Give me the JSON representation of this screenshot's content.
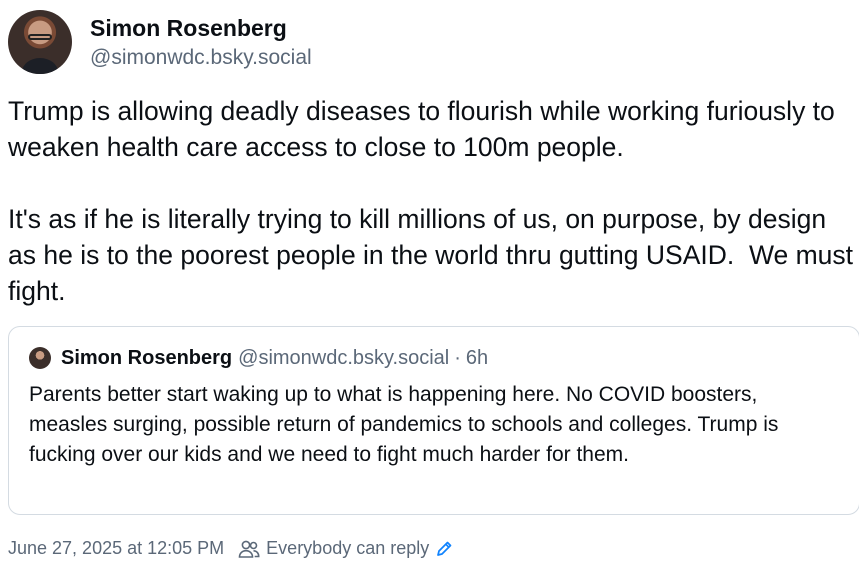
{
  "author": {
    "display_name": "Simon Rosenberg",
    "handle": "@simonwdc.bsky.social"
  },
  "post": {
    "text": "Trump is allowing deadly diseases to flourish while working furiously to weaken health care access to close to 100m people.\n\nIt's as if he is literally trying to kill millions of us, on purpose, by design as he is to the poorest people in the world thru gutting USAID.  We must fight."
  },
  "quote": {
    "display_name": "Simon Rosenberg",
    "handle": "@simonwdc.bsky.social",
    "separator": "·",
    "time": "6h",
    "text": "Parents better start waking up to what is happening here.  No COVID boosters, measles surging, possible return of pandemics to schools and colleges.  Trump is fucking over our kids and we need to fight much harder for them."
  },
  "meta": {
    "date": "June 27, 2025 at 12:05 PM",
    "reply_setting": "Everybody can reply",
    "people_icon": "people-icon",
    "edit_icon": "pencil-icon"
  },
  "colors": {
    "text_primary": "#0b0f14",
    "text_secondary": "#5b6878",
    "border": "#d4dbe2",
    "accent": "#1083fe"
  }
}
